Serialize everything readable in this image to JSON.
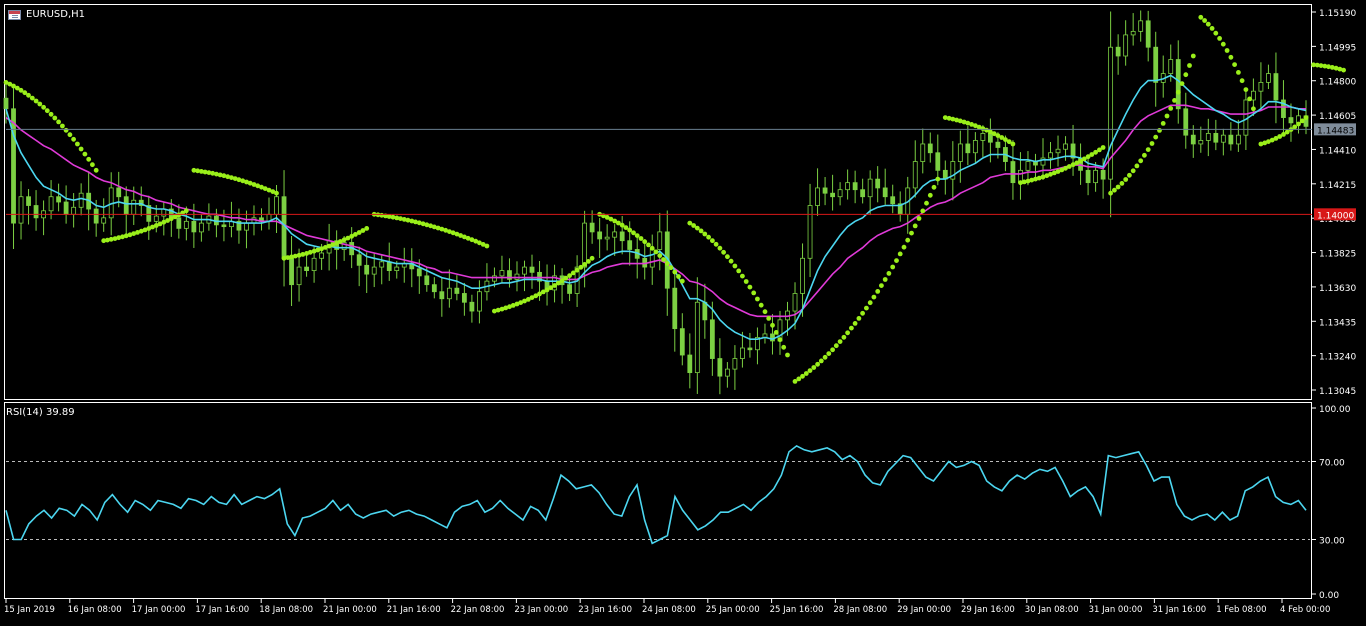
{
  "window": {
    "symbol_label": "EURUSD,H1",
    "rsi_label": "RSI(14) 39.89"
  },
  "colors": {
    "background": "#000000",
    "candles": "#7cd043",
    "sar_dots": "#9aef1a",
    "ma_fast": "#4cd6f0",
    "ma_slow": "#e03ad8",
    "rsi": "#4cd6f0",
    "bid_line": "#6a7f90",
    "alert_line": "#d81818",
    "grid_text": "#ffffff"
  },
  "chart_data": [
    {
      "type": "line",
      "title": "EURUSD,H1",
      "ylim": [
        1.1295,
        1.1519
      ],
      "y_ticks": [
        "1.15190",
        "1.14995",
        "1.14800",
        "1.14605",
        "1.14410",
        "1.14215",
        "1.14020",
        "1.13825",
        "1.13630",
        "1.13435",
        "1.13240",
        "1.13045"
      ],
      "x_ticks": [
        "15 Jan 2019",
        "16 Jan 08:00",
        "17 Jan 00:00",
        "17 Jan 16:00",
        "18 Jan 08:00",
        "21 Jan 00:00",
        "21 Jan 16:00",
        "22 Jan 08:00",
        "23 Jan 00:00",
        "23 Jan 16:00",
        "24 Jan 08:00",
        "25 Jan 00:00",
        "25 Jan 16:00",
        "28 Jan 08:00",
        "29 Jan 00:00",
        "29 Jan 16:00",
        "30 Jan 08:00",
        "31 Jan 00:00",
        "31 Jan 16:00",
        "1 Feb 08:00",
        "4 Feb 00:00"
      ],
      "current_price": "1.14483",
      "alert_price": "1.14000",
      "alert_value": 1.14,
      "current_value": 1.14483,
      "close_series": [
        1.146,
        1.1395,
        1.141,
        1.1405,
        1.1398,
        1.1402,
        1.141,
        1.1407,
        1.14,
        1.1404,
        1.1412,
        1.1403,
        1.1395,
        1.1398,
        1.1415,
        1.141,
        1.14,
        1.1408,
        1.1405,
        1.1396,
        1.1399,
        1.1403,
        1.1398,
        1.1392,
        1.1396,
        1.139,
        1.1395,
        1.1399,
        1.1394,
        1.1393,
        1.1396,
        1.1391,
        1.1395,
        1.1398,
        1.1396,
        1.14,
        1.141,
        1.1375,
        1.136,
        1.137,
        1.1368,
        1.1375,
        1.1378,
        1.1385,
        1.138,
        1.1384,
        1.1377,
        1.1371,
        1.1366,
        1.137,
        1.1373,
        1.1368,
        1.137,
        1.1372,
        1.1369,
        1.1365,
        1.136,
        1.1356,
        1.1352,
        1.1358,
        1.1355,
        1.135,
        1.1345,
        1.1356,
        1.1362,
        1.1365,
        1.1368,
        1.1363,
        1.1366,
        1.137,
        1.1367,
        1.1362,
        1.1357,
        1.1365,
        1.136,
        1.1355,
        1.137,
        1.1395,
        1.139,
        1.1386,
        1.1387,
        1.139,
        1.1385,
        1.138,
        1.1375,
        1.137,
        1.138,
        1.139,
        1.1358,
        1.1335,
        1.132,
        1.131,
        1.135,
        1.134,
        1.1318,
        1.1308,
        1.1312,
        1.1318,
        1.1324,
        1.1323,
        1.133,
        1.1332,
        1.1328,
        1.134,
        1.1345,
        1.1355,
        1.1375,
        1.1405,
        1.1415,
        1.1412,
        1.141,
        1.1414,
        1.1418,
        1.1414,
        1.141,
        1.142,
        1.1415,
        1.141,
        1.1406,
        1.14,
        1.1415,
        1.143,
        1.144,
        1.1435,
        1.1425,
        1.142,
        1.143,
        1.144,
        1.1435,
        1.1442,
        1.1446,
        1.1441,
        1.1438,
        1.143,
        1.1418,
        1.1425,
        1.143,
        1.1428,
        1.1432,
        1.1435,
        1.1437,
        1.144,
        1.1432,
        1.1425,
        1.1418,
        1.1425,
        1.142,
        1.1495,
        1.149,
        1.1502,
        1.1504,
        1.151,
        1.1495,
        1.1475,
        1.148,
        1.1488,
        1.146,
        1.1445,
        1.144,
        1.1442,
        1.1446,
        1.1441,
        1.1445,
        1.144,
        1.1445,
        1.1465,
        1.147,
        1.1475,
        1.148,
        1.1465,
        1.1455,
        1.1452,
        1.1456,
        1.145
      ],
      "ma_fast": [
        1.146,
        1.1445,
        1.1435,
        1.1428,
        1.1421,
        1.1416,
        1.1414,
        1.1412,
        1.1409,
        1.1408,
        1.1409,
        1.1408,
        1.1405,
        1.1404,
        1.1406,
        1.1407,
        1.1406,
        1.1406,
        1.1406,
        1.1404,
        1.1403,
        1.1403,
        1.1402,
        1.14,
        1.1399,
        1.1397,
        1.1397,
        1.1397,
        1.1396,
        1.1396,
        1.1396,
        1.1395,
        1.1395,
        1.1395,
        1.1395,
        1.1396,
        1.1398,
        1.1394,
        1.1389,
        1.1386,
        1.1383,
        1.1382,
        1.1381,
        1.1382,
        1.1381,
        1.1381,
        1.1381,
        1.1379,
        1.1376,
        1.1375,
        1.1374,
        1.1373,
        1.1372,
        1.1372,
        1.1372,
        1.137,
        1.1368,
        1.1366,
        1.1364,
        1.1363,
        1.1362,
        1.136,
        1.1358,
        1.1358,
        1.1359,
        1.136,
        1.1361,
        1.1361,
        1.1362,
        1.1363,
        1.1363,
        1.1363,
        1.1362,
        1.1362,
        1.1362,
        1.1361,
        1.1362,
        1.1367,
        1.1371,
        1.1373,
        1.1376,
        1.1378,
        1.1379,
        1.1379,
        1.1378,
        1.1376,
        1.1377,
        1.1379,
        1.1375,
        1.1368,
        1.136,
        1.1352,
        1.1352,
        1.135,
        1.1346,
        1.134,
        1.1336,
        1.1333,
        1.1331,
        1.1329,
        1.1329,
        1.133,
        1.1329,
        1.1331,
        1.1334,
        1.1338,
        1.1346,
        1.1357,
        1.1368,
        1.1376,
        1.1382,
        1.1388,
        1.1393,
        1.1396,
        1.1398,
        1.1402,
        1.1404,
        1.1405,
        1.1405,
        1.1405,
        1.1407,
        1.1411,
        1.1416,
        1.1419,
        1.142,
        1.142,
        1.1422,
        1.1425,
        1.1427,
        1.1429,
        1.1432,
        1.1434,
        1.1434,
        1.1434,
        1.1432,
        1.1431,
        1.1431,
        1.143,
        1.1431,
        1.1431,
        1.1432,
        1.1433,
        1.1433,
        1.1432,
        1.1429,
        1.1428,
        1.1427,
        1.1439,
        1.1448,
        1.1457,
        1.1465,
        1.1472,
        1.1476,
        1.1476,
        1.1477,
        1.1479,
        1.1476,
        1.1472,
        1.1468,
        1.1465,
        1.1462,
        1.1459,
        1.1457,
        1.1454,
        1.1452,
        1.1454,
        1.1457,
        1.146,
        1.1464,
        1.1464,
        1.1463,
        1.1461,
        1.146,
        1.1459
      ],
      "ma_slow": [
        1.1455,
        1.1452,
        1.1448,
        1.1445,
        1.1442,
        1.1439,
        1.1437,
        1.1434,
        1.1431,
        1.1428,
        1.1426,
        1.1424,
        1.1421,
        1.1419,
        1.1418,
        1.1416,
        1.1414,
        1.1413,
        1.1411,
        1.141,
        1.1408,
        1.1407,
        1.1406,
        1.1404,
        1.1403,
        1.1402,
        1.1401,
        1.14,
        1.14,
        1.1399,
        1.1398,
        1.1398,
        1.1397,
        1.1397,
        1.1396,
        1.1396,
        1.1396,
        1.1394,
        1.1392,
        1.139,
        1.1388,
        1.1387,
        1.1386,
        1.1385,
        1.1384,
        1.1383,
        1.1382,
        1.1381,
        1.1379,
        1.1378,
        1.1377,
        1.1376,
        1.1375,
        1.1374,
        1.1373,
        1.1372,
        1.137,
        1.1369,
        1.1367,
        1.1367,
        1.1366,
        1.1365,
        1.1364,
        1.1364,
        1.1364,
        1.1364,
        1.1364,
        1.1364,
        1.1364,
        1.1364,
        1.1364,
        1.1364,
        1.1364,
        1.1364,
        1.1363,
        1.1363,
        1.1363,
        1.1365,
        1.1367,
        1.1368,
        1.137,
        1.1371,
        1.1372,
        1.1372,
        1.1372,
        1.1372,
        1.1373,
        1.1374,
        1.1372,
        1.1369,
        1.1366,
        1.1362,
        1.1361,
        1.1359,
        1.1356,
        1.1352,
        1.1349,
        1.1347,
        1.1345,
        1.1343,
        1.1342,
        1.1342,
        1.1342,
        1.1342,
        1.1342,
        1.1343,
        1.1346,
        1.1351,
        1.1356,
        1.1361,
        1.1366,
        1.137,
        1.1375,
        1.1378,
        1.1381,
        1.1385,
        1.1388,
        1.139,
        1.1392,
        1.1393,
        1.1395,
        1.1398,
        1.1401,
        1.1404,
        1.1406,
        1.1407,
        1.1409,
        1.1412,
        1.1414,
        1.1416,
        1.1418,
        1.1421,
        1.1422,
        1.1423,
        1.1423,
        1.1423,
        1.1424,
        1.1424,
        1.1425,
        1.1425,
        1.1426,
        1.1427,
        1.1428,
        1.1428,
        1.1427,
        1.1427,
        1.1426,
        1.1432,
        1.1437,
        1.1442,
        1.1448,
        1.1453,
        1.1456,
        1.1458,
        1.146,
        1.1462,
        1.1462,
        1.1462,
        1.1461,
        1.146,
        1.146,
        1.1459,
        1.1458,
        1.1457,
        1.1457,
        1.1457,
        1.1458,
        1.1459,
        1.1461,
        1.1461,
        1.1461,
        1.1461,
        1.146,
        1.146
      ],
      "sar_segments": [
        {
          "start": 0,
          "end": 12,
          "from": 1.1475,
          "to": 1.1425
        },
        {
          "start": 13,
          "end": 24,
          "from": 1.1385,
          "to": 1.1402
        },
        {
          "start": 25,
          "end": 36,
          "from": 1.1425,
          "to": 1.1412
        },
        {
          "start": 37,
          "end": 48,
          "from": 1.1375,
          "to": 1.1392
        },
        {
          "start": 49,
          "end": 64,
          "from": 1.14,
          "to": 1.1382
        },
        {
          "start": 65,
          "end": 78,
          "from": 1.1345,
          "to": 1.1375
        },
        {
          "start": 79,
          "end": 90,
          "from": 1.14,
          "to": 1.1362
        },
        {
          "start": 91,
          "end": 104,
          "from": 1.1395,
          "to": 1.132
        },
        {
          "start": 105,
          "end": 124,
          "from": 1.1305,
          "to": 1.142
        },
        {
          "start": 125,
          "end": 134,
          "from": 1.1455,
          "to": 1.144
        },
        {
          "start": 135,
          "end": 146,
          "from": 1.1418,
          "to": 1.1438
        },
        {
          "start": 147,
          "end": 158,
          "from": 1.1412,
          "to": 1.149
        },
        {
          "start": 159,
          "end": 166,
          "from": 1.1512,
          "to": 1.146
        },
        {
          "start": 167,
          "end": 173,
          "from": 1.144,
          "to": 1.1455
        },
        {
          "start": 174,
          "end": 178,
          "from": 1.1485,
          "to": 1.1482
        }
      ]
    },
    {
      "type": "line",
      "title": "RSI(14) 39.89",
      "ylim": [
        0,
        100
      ],
      "y_ticks": [
        "100.00",
        "70.00",
        "30.00",
        "0.00"
      ],
      "levels": [
        70,
        30
      ],
      "values": [
        45,
        30,
        30,
        38,
        42,
        45,
        41,
        46,
        45,
        42,
        48,
        45,
        40,
        49,
        53,
        48,
        44,
        50,
        48,
        45,
        50,
        49,
        48,
        46,
        51,
        50,
        48,
        52,
        49,
        48,
        53,
        48,
        50,
        52,
        51,
        53,
        56,
        38,
        32,
        41,
        42,
        44,
        46,
        50,
        45,
        48,
        43,
        41,
        43,
        44,
        45,
        42,
        44,
        45,
        43,
        42,
        40,
        38,
        36,
        44,
        47,
        48,
        50,
        44,
        46,
        50,
        46,
        43,
        40,
        47,
        45,
        40,
        51,
        63,
        60,
        56,
        57,
        58,
        54,
        48,
        43,
        42,
        52,
        58,
        40,
        28,
        30,
        32,
        52,
        45,
        40,
        35,
        37,
        40,
        44,
        44,
        46,
        48,
        45,
        49,
        52,
        56,
        63,
        75,
        78,
        76,
        75,
        76,
        77,
        75,
        71,
        73,
        70,
        63,
        59,
        58,
        65,
        69,
        73,
        72,
        67,
        62,
        60,
        65,
        70,
        67,
        68,
        70,
        68,
        60,
        57,
        55,
        60,
        63,
        61,
        64,
        66,
        65,
        67,
        60,
        52,
        55,
        57,
        52,
        43,
        73,
        72,
        73,
        74,
        75,
        68,
        60,
        62,
        62,
        48,
        42,
        40,
        42,
        43,
        40,
        44,
        40,
        42,
        55,
        57,
        60,
        62,
        52,
        49,
        48,
        50,
        45
      ]
    }
  ]
}
